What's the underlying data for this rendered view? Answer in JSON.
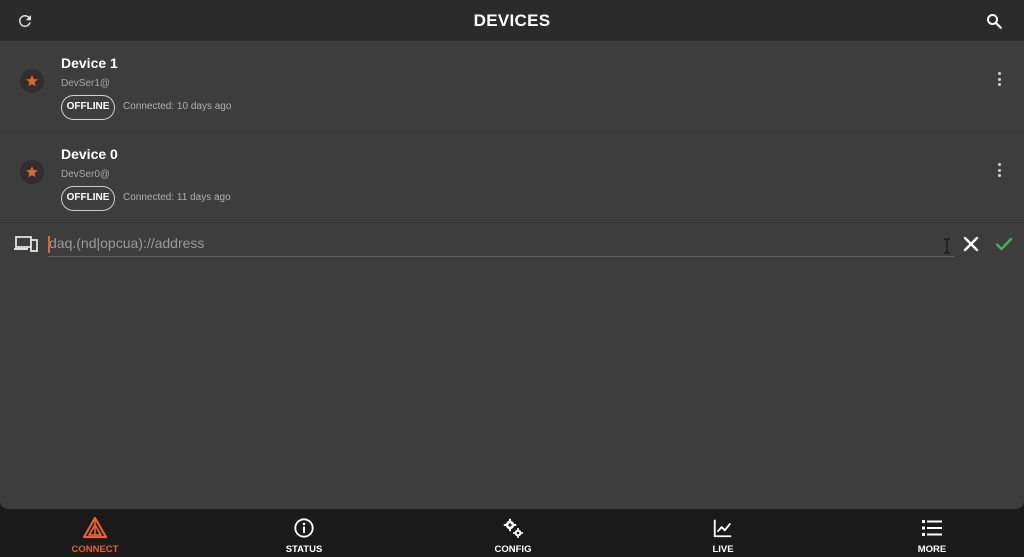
{
  "header": {
    "title": "DEVICES",
    "left_icon": "refresh-icon",
    "right_icon": "search-icon"
  },
  "devices": [
    {
      "name": "Device 1",
      "serial": "DevSer1@",
      "status": "OFFLINE",
      "connected": "Connected: 10 days ago",
      "favorite": true
    },
    {
      "name": "Device 0",
      "serial": "DevSer0@",
      "status": "OFFLINE",
      "connected": "Connected: 11 days ago",
      "favorite": true
    }
  ],
  "connect": {
    "placeholder": "daq.(nd|opcua)://address",
    "value": "",
    "device_icon": "devices-icon",
    "clear_icon": "close-icon",
    "confirm_icon": "check-icon"
  },
  "tabs": [
    {
      "label": "CONNECT",
      "icon": "connect-logo-icon",
      "active": true
    },
    {
      "label": "STATUS",
      "icon": "info-icon",
      "active": false
    },
    {
      "label": "CONFIG",
      "icon": "gears-icon",
      "active": false
    },
    {
      "label": "LIVE",
      "icon": "chart-line-icon",
      "active": false
    },
    {
      "label": "MORE",
      "icon": "list-icon",
      "active": false
    }
  ],
  "colors": {
    "accent": "#e8622d",
    "confirm": "#4caf50",
    "background": "#3d3d3d",
    "header": "#2b2b2b",
    "tabbar": "#1a1a1a"
  }
}
